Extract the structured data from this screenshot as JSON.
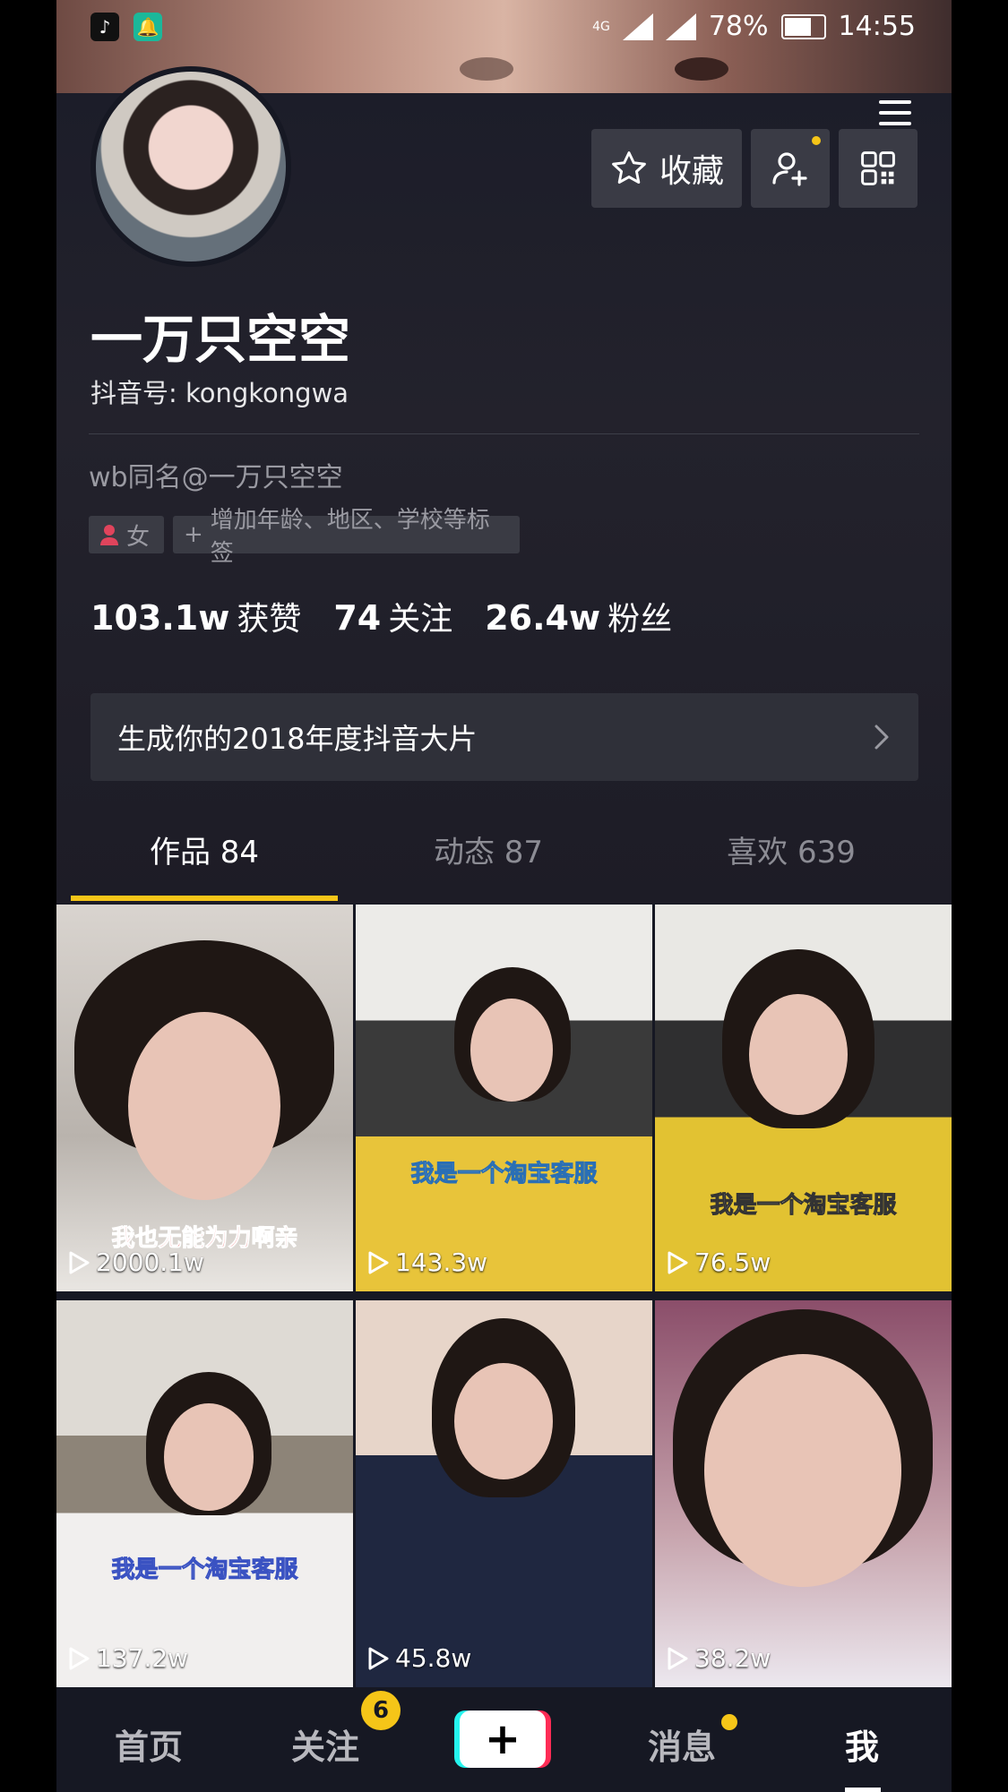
{
  "status_bar": {
    "network": "4G",
    "battery": "78%",
    "battery_level": 0.78,
    "time": "14:55"
  },
  "header": {
    "favorite_label": "收藏"
  },
  "profile": {
    "nickname": "一万只空空",
    "douyin_id": "抖音号: kongkongwa",
    "bio": "wb同名@一万只空空",
    "gender_tag": "女",
    "add_tag_label": "增加年龄、地区、学校等标签"
  },
  "stats": {
    "likes": {
      "value": "103.1w",
      "label": "获赞"
    },
    "following": {
      "value": "74",
      "label": "关注"
    },
    "followers": {
      "value": "26.4w",
      "label": "粉丝"
    }
  },
  "banner": {
    "text": "生成你的2018年度抖音大片"
  },
  "tabs": [
    {
      "label": "作品 84",
      "active": true
    },
    {
      "label": "动态 87",
      "active": false
    },
    {
      "label": "喜欢 639",
      "active": false
    }
  ],
  "videos": [
    {
      "plays": "2000.1w",
      "caption": "我也无能为力啊亲"
    },
    {
      "plays": "143.3w",
      "caption": "我是一个淘宝客服"
    },
    {
      "plays": "76.5w",
      "caption": "我是一个淘宝客服"
    },
    {
      "plays": "137.2w",
      "caption": "我是一个淘宝客服"
    },
    {
      "plays": "45.8w",
      "caption": ""
    },
    {
      "plays": "38.2w",
      "caption": ""
    }
  ],
  "bottom_nav": {
    "home": "首页",
    "follow": "关注",
    "follow_badge": "6",
    "add": "+",
    "messages": "消息",
    "me": "我"
  },
  "colors": {
    "background": "#161823",
    "accent_yellow": "#f5c518",
    "tiktok_cyan": "#25f4ee",
    "tiktok_red": "#fe2c55"
  }
}
